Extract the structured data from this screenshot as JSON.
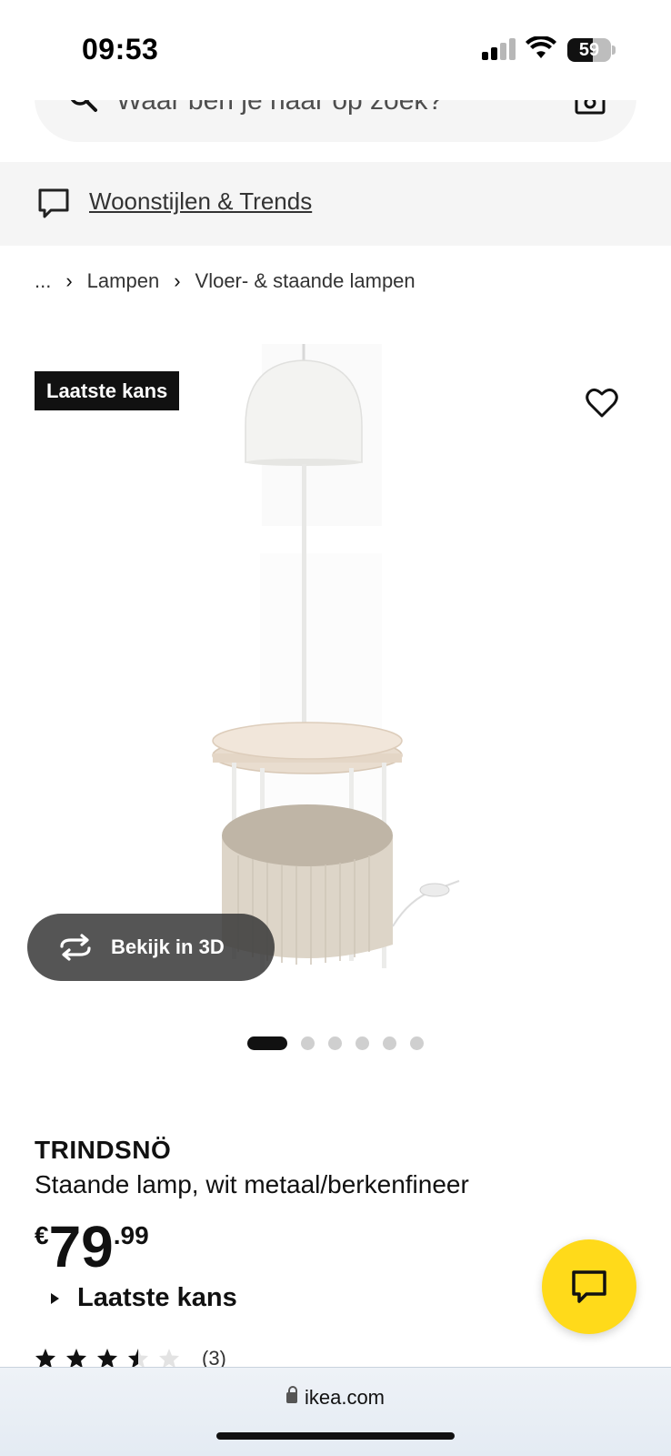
{
  "status_bar": {
    "time": "09:53",
    "battery": "59",
    "icons": [
      "signal-icon",
      "wifi-icon",
      "battery-icon"
    ]
  },
  "search": {
    "placeholder": "Waar ben je naar op zoek?",
    "icons": [
      "search-icon",
      "camera-icon"
    ]
  },
  "inspiration": {
    "label": "Woonstijlen & Trends",
    "icon": "speech-bubble-icon"
  },
  "breadcrumb": {
    "items": [
      "...",
      "Lampen",
      "Vloer- & staande lampen"
    ]
  },
  "product": {
    "badge": "Laatste kans",
    "view_3d_label": "Bekijk in 3D",
    "carousel": {
      "count": 6,
      "active_index": 0
    },
    "name": "TRINDSNÖ",
    "description": "Staande lamp, wit metaal/berkenfineer",
    "price": {
      "currency": "€",
      "integer": "79",
      "decimals": ".99"
    },
    "availability": "Laatste kans",
    "rating": {
      "stars": 3.5,
      "max": 5,
      "count": "(3)"
    }
  },
  "browser": {
    "url": "ikea.com"
  },
  "colors": {
    "accent_yellow": "#ffda1a",
    "badge_bg": "#111111",
    "light_gray": "#f5f5f5"
  }
}
